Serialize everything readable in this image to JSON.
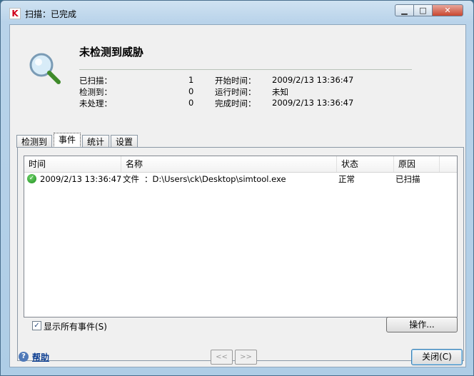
{
  "window": {
    "title": "扫描：已完成",
    "minimize_glyph": "▁",
    "maximize_glyph": "□",
    "close_glyph": "✕"
  },
  "summary": {
    "heading": "未检测到威胁",
    "scanned_label": "已扫描：",
    "scanned_value": "1",
    "detected_label": "检测到：",
    "detected_value": "0",
    "unprocessed_label": "未处理：",
    "unprocessed_value": "0",
    "start_label": "开始时间：",
    "start_value": "2009/2/13 13:36:47",
    "runtime_label": "运行时间：",
    "runtime_value": "未知",
    "finish_label": "完成时间：",
    "finish_value": "2009/2/13 13:36:47"
  },
  "tabs": [
    {
      "label": "检测到"
    },
    {
      "label": "事件",
      "active": true
    },
    {
      "label": "统计"
    },
    {
      "label": "设置"
    }
  ],
  "events": {
    "columns": [
      "时间",
      "名称",
      "状态",
      "原因"
    ],
    "rows": [
      {
        "time": "2009/2/13 13:36:47",
        "type": "文件",
        "name": "：D:\\Users\\ck\\Desktop\\simtool.exe",
        "status": "正常",
        "reason": "已扫描"
      }
    ]
  },
  "show_all_events": {
    "label": "显示所有事件(S)",
    "checked": true
  },
  "buttons": {
    "operations": "操作...",
    "help": "帮助",
    "prev": "<<",
    "next": ">>",
    "close": "关闭(C)"
  },
  "icons": {
    "app": "kaspersky-k-icon",
    "status": "magnifier-icon",
    "row_status": "check-circle-icon",
    "help": "question-icon"
  },
  "colors": {
    "accent_link": "#0b3d91",
    "ok_green": "#1f8f1f",
    "close_red": "#c9462f"
  }
}
